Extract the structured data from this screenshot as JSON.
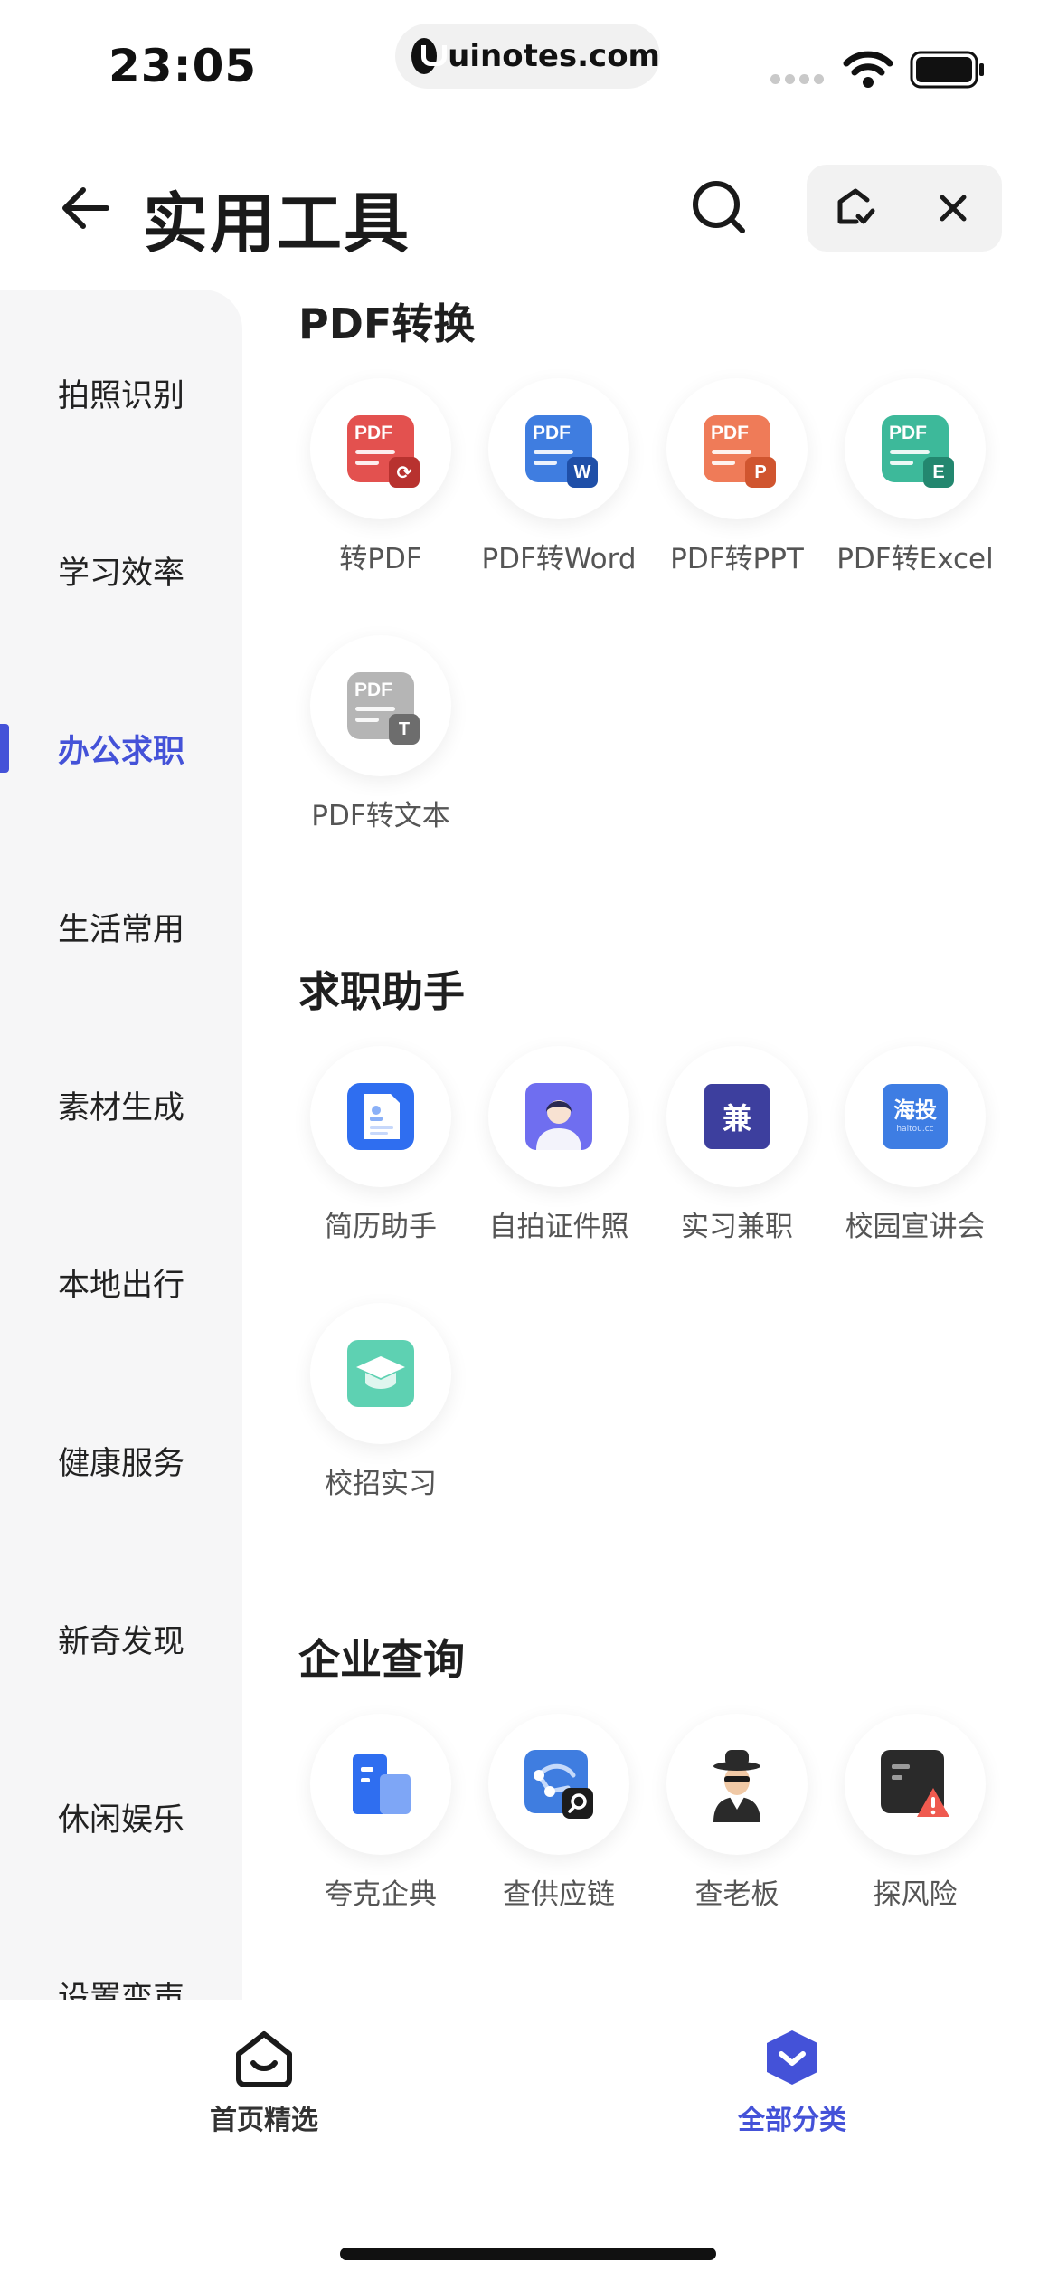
{
  "status_bar": {
    "time": "23:05",
    "url": "uinotes.com"
  },
  "header": {
    "title": "实用工具"
  },
  "sidebar": {
    "items": [
      {
        "label": "拍照识别"
      },
      {
        "label": "学习效率"
      },
      {
        "label": "办公求职",
        "active": true
      },
      {
        "label": "生活常用"
      },
      {
        "label": "素材生成"
      },
      {
        "label": "本地出行"
      },
      {
        "label": "健康服务"
      },
      {
        "label": "新奇发现"
      },
      {
        "label": "休闲娱乐"
      },
      {
        "label": "设置变声"
      }
    ]
  },
  "sections": [
    {
      "title": "PDF转换",
      "tools": [
        {
          "label": "转PDF",
          "icon": "pdf-convert-icon",
          "color": "#e3514f",
          "badge": "C"
        },
        {
          "label": "PDF转Word",
          "icon": "pdf-to-word-icon",
          "color": "#3f7de0",
          "badge": "W"
        },
        {
          "label": "PDF转PPT",
          "icon": "pdf-to-ppt-icon",
          "color": "#ef7b58",
          "badge": "P"
        },
        {
          "label": "PDF转Excel",
          "icon": "pdf-to-excel-icon",
          "color": "#3db99a",
          "badge": "E"
        },
        {
          "label": "PDF转文本",
          "icon": "pdf-to-text-icon",
          "color": "#b5b5b5",
          "badge": "T"
        }
      ]
    },
    {
      "title": "求职助手",
      "tools": [
        {
          "label": "简历助手",
          "icon": "resume-icon"
        },
        {
          "label": "自拍证件照",
          "icon": "id-photo-icon"
        },
        {
          "label": "实习兼职",
          "icon": "part-time-icon",
          "badge": "兼"
        },
        {
          "label": "校园宣讲会",
          "icon": "campus-talk-icon",
          "badge": "海投",
          "sub": "haitou.cc"
        },
        {
          "label": "校招实习",
          "icon": "graduation-cap-icon"
        }
      ]
    },
    {
      "title": "企业查询",
      "tools": [
        {
          "label": "夸克企典",
          "icon": "company-building-icon"
        },
        {
          "label": "查供应链",
          "icon": "supply-chain-icon"
        },
        {
          "label": "查老板",
          "icon": "boss-detective-icon"
        },
        {
          "label": "探风险",
          "icon": "risk-warning-icon"
        }
      ]
    }
  ],
  "tabbar": {
    "tabs": [
      {
        "label": "首页精选",
        "icon": "home-icon"
      },
      {
        "label": "全部分类",
        "icon": "category-icon",
        "active": true
      }
    ]
  },
  "colors": {
    "accent": "#4452d8",
    "sidebar_bg": "#f6f6f7"
  }
}
